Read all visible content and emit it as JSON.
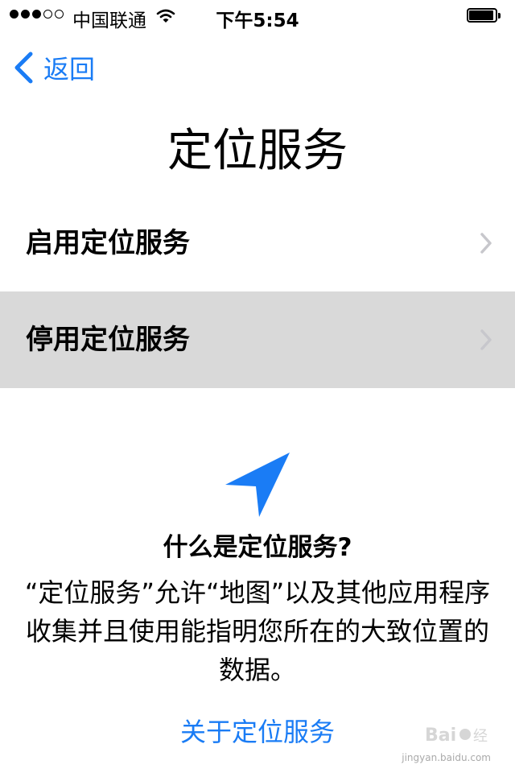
{
  "status_bar": {
    "carrier": "中国联通",
    "time": "下午5:54",
    "signal_bars": 3,
    "signal_total": 5,
    "icons": [
      "signal-dots-icon",
      "wifi-icon",
      "battery-icon"
    ]
  },
  "nav": {
    "back_label": "返回"
  },
  "page_title": "定位服务",
  "rows": [
    {
      "label": "启用定位服务",
      "selected": false
    },
    {
      "label": "停用定位服务",
      "selected": true
    }
  ],
  "info": {
    "icon": "location-arrow-icon",
    "heading": "什么是定位服务?",
    "body": "“定位服务”允许“地图”以及其他应用程序收集并且使用能指明您所在的大致位置的数据。",
    "link": "关于定位服务"
  },
  "colors": {
    "accent": "#1a7cf5",
    "selected_row": "#d9d9d9",
    "chevron": "#c7c7cc"
  },
  "watermark": {
    "subtext": "jingyan.baidu.com"
  }
}
